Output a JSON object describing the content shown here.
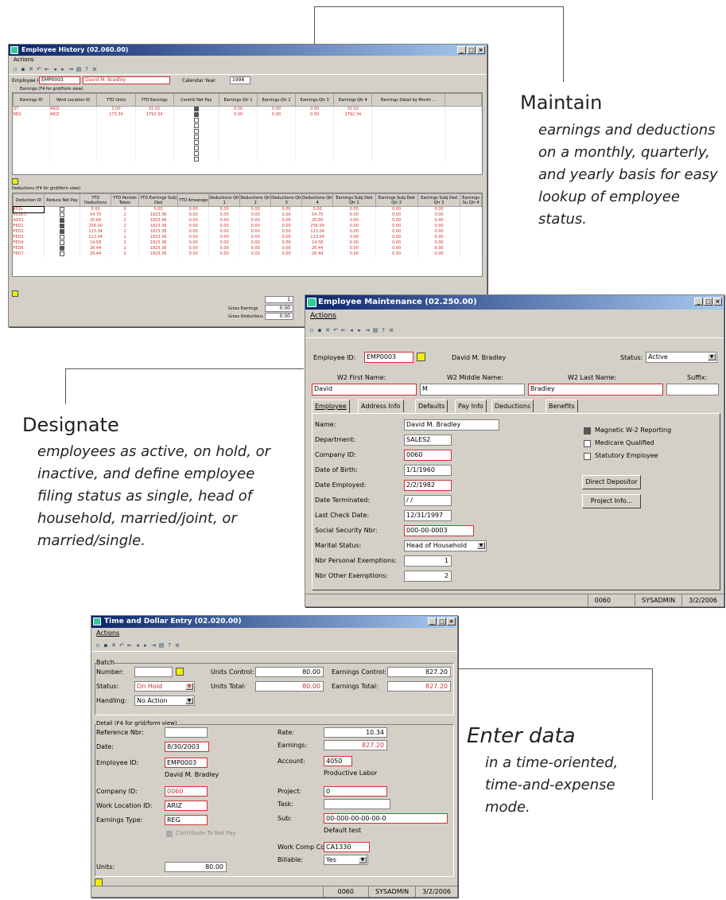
{
  "callouts": {
    "maintain": {
      "heading": "Maintain",
      "text_lines": [
        "earnings and deductions",
        "on a monthly, quarterly,",
        "and yearly basis for easy",
        "lookup of employee",
        "status."
      ]
    },
    "designate": {
      "heading": "Designate",
      "text_lines": [
        "employees as active, on hold, or",
        "inactive, and define employee",
        "filing status as single, head of",
        "household, married/joint, or",
        "married/single."
      ]
    },
    "enter": {
      "heading": "Enter data",
      "text_lines": [
        "in a time-oriented,",
        "time-and-expense",
        "mode."
      ]
    }
  },
  "history": {
    "title": "Employee History (02.060.00)",
    "menu": "Actions",
    "employee_label": "Employee ID:",
    "employee_id": "EMP0003",
    "employee_name": "David M. Bradley",
    "calendar_label": "Calendar Year:",
    "calendar_year": "1998",
    "earnings_caption": "Earnings (F4 for grid/form view)",
    "earnings_headers": [
      "Earnings ID",
      "Work Location ID",
      "YTD Units",
      "YTD Earnings",
      "Contrib Net Pay",
      "Earnings Qtr 1",
      "Earnings Qtr 2",
      "Earnings Qtr 3",
      "Earnings Qtr 4",
      "Earnings Detail by Month ..."
    ],
    "earnings_rows": [
      [
        "OT",
        "ARIZ",
        "2.00",
        "31.02",
        "0.00",
        "0.00",
        "0.00",
        "31.02"
      ],
      [
        "REG",
        "ARIZ",
        "173.34",
        "1792.34",
        "0.00",
        "0.00",
        "0.00",
        "1792.34"
      ]
    ],
    "deductions_caption": "Deductions (F4 for grid/form view)",
    "deductions_headers": [
      "Deduction ID",
      "Reduce Net Pay",
      "YTD Deductions",
      "YTD Periods Taken",
      "YTD Earnings Subj Ded",
      "YTD Arrearage",
      "Deductions Qtr 1",
      "Deductions Qtr 2",
      "Deductions Qtr 3",
      "Deductions Qtr 4",
      "Earnings Subj Ded Qtr 1",
      "Earnings Subj Ded Qtr 2",
      "Earnings Subj Ded Qtr 3",
      "Earnings Su Qtr 4"
    ],
    "deductions_rows": [
      [
        "401k",
        "",
        "0.00",
        "0",
        "0.00",
        "0.00",
        "0.00",
        "0.00",
        "0.00",
        "0.00",
        "0.00",
        "0.00",
        "0.00"
      ],
      [
        "401K-C",
        "",
        "54.70",
        "2",
        "1823.36",
        "0.00",
        "0.00",
        "0.00",
        "0.00",
        "54.70",
        "0.00",
        "0.00",
        "0.00"
      ],
      [
        "AZ01",
        "x",
        "20.60",
        "2",
        "1823.36",
        "0.00",
        "0.00",
        "0.00",
        "0.00",
        "20.60",
        "0.00",
        "0.00",
        "0.00"
      ],
      [
        "FED1",
        "x",
        "256.00",
        "2",
        "1823.36",
        "0.00",
        "0.00",
        "0.00",
        "0.00",
        "256.00",
        "0.00",
        "0.00",
        "0.00"
      ],
      [
        "FED2",
        "x",
        "113.04",
        "2",
        "1823.36",
        "0.00",
        "0.00",
        "0.00",
        "0.00",
        "113.04",
        "0.00",
        "0.00",
        "0.00"
      ],
      [
        "FED3",
        "",
        "113.04",
        "2",
        "1823.36",
        "0.00",
        "0.00",
        "0.00",
        "0.00",
        "113.04",
        "0.00",
        "0.00",
        "0.00"
      ],
      [
        "FED4",
        "",
        "14.58",
        "2",
        "1823.36",
        "0.00",
        "0.00",
        "0.00",
        "0.00",
        "14.58",
        "0.00",
        "0.00",
        "0.00"
      ],
      [
        "FED6",
        "x",
        "26.44",
        "2",
        "1823.36",
        "0.00",
        "0.00",
        "0.00",
        "0.00",
        "26.44",
        "0.00",
        "0.00",
        "0.00"
      ],
      [
        "FED7",
        "",
        "26.44",
        "2",
        "1823.36",
        "0.00",
        "0.00",
        "0.00",
        "0.00",
        "26.44",
        "0.00",
        "0.00",
        "0.00"
      ]
    ],
    "page_value": "1",
    "gross_earnings_label": "Gross Earnings",
    "gross_earnings": "0.00",
    "gross_deductions_label": "Gross Deductions",
    "gross_deductions": "0.00"
  },
  "maint": {
    "title": "Employee Maintenance (02.250.00)",
    "menu": "Actions",
    "employee_label": "Employee ID:",
    "employee_id": "EMP0003",
    "employee_name": "David M. Bradley",
    "status_label": "Status:",
    "status": "Active",
    "first_label": "W2 First Name:",
    "middle_label": "W2 Middle Name:",
    "last_label": "W2 Last Name:",
    "suffix_label": "Suffix:",
    "first": "David",
    "middle": "M",
    "last": "Bradley",
    "tabs": [
      "Employee",
      "Address Info",
      "Defaults",
      "Pay Info",
      "Deductions",
      "Benefits"
    ],
    "fields": [
      {
        "label": "Name:",
        "value": "David M. Bradley"
      },
      {
        "label": "Department:",
        "value": "SALES2"
      },
      {
        "label": "Company ID:",
        "value": "0060"
      },
      {
        "label": "Date of Birth:",
        "value": "1/1/1960"
      },
      {
        "label": "Date Employed:",
        "value": "2/2/1982"
      },
      {
        "label": "Date Terminated:",
        "value": "/ /"
      },
      {
        "label": "Last Check Date:",
        "value": "12/31/1997"
      },
      {
        "label": "Social Security Nbr:",
        "value": "000-00-0003"
      },
      {
        "label": "Marital Status:",
        "value": "Head of Household"
      },
      {
        "label": "Nbr Personal Exemptions:",
        "value": "1"
      },
      {
        "label": "Nbr Other Exemptions:",
        "value": "2"
      }
    ],
    "chk_w2": "Magnetic W-2 Reporting",
    "chk_medicare": "Medicare Qualified",
    "chk_statutory": "Statutory Employee",
    "btn_deposit": "Direct Depositor",
    "btn_project": "Project Info...",
    "status_company": "0060",
    "status_user": "SYSADMIN",
    "status_date": "3/2/2006"
  },
  "tde": {
    "title": "Time and Dollar Entry (02.020.00)",
    "menu": "Actions",
    "batch_caption": "Batch",
    "number_label": "Number:",
    "status_label": "Status:",
    "status": "On Hold",
    "handling_label": "Handling:",
    "handling": "No Action",
    "units_control_label": "Units Control:",
    "units_control": "80.00",
    "units_total_label": "Units Total:",
    "units_total": "80.00",
    "earn_control_label": "Earnings Control:",
    "earn_control": "827.20",
    "earn_total_label": "Earnings Total:",
    "earn_total": "827.20",
    "detail_caption": "Detail (F4 for grid/form view)",
    "ref_label": "Reference Nbr:",
    "date_label": "Date:",
    "date": "8/30/2003",
    "emp_label": "Employee ID:",
    "emp": "EMP0003",
    "emp_name": "David M. Bradley",
    "company_label": "Company ID:",
    "company": "0060",
    "workloc_label": "Work Location ID:",
    "workloc": "ARIZ",
    "etype_label": "Earnings Type:",
    "etype": "REG",
    "contrib_label": "Contribute To Net Pay",
    "units_label": "Units:",
    "units": "80.00",
    "rate_label": "Rate:",
    "rate": "10.34",
    "earnings_label": "Earnings:",
    "earnings": "827.20",
    "account_label": "Account:",
    "account": "4050",
    "account_desc": "Productive Labor",
    "project_label": "Project:",
    "project": "0",
    "task_label": "Task:",
    "sub_label": "Sub:",
    "sub": "00-000-00-00-00-0",
    "sub_desc": "Default test",
    "wcc_label": "Work Comp Cd:",
    "wcc": "CA1330",
    "billable_label": "Billable:",
    "billable": "Yes",
    "status_company": "0060",
    "status_user": "SYSADMIN",
    "status_date": "3/2/2006"
  }
}
